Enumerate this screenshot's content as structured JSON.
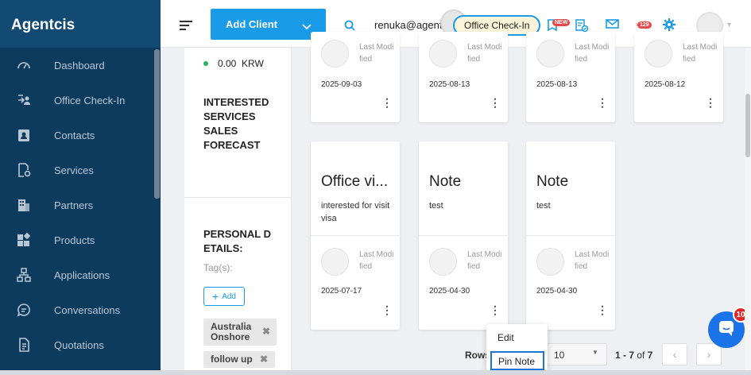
{
  "app": {
    "brand": "Agentcis"
  },
  "sidebar": {
    "items": [
      {
        "label": "Dashboard",
        "icon": "gauge-icon"
      },
      {
        "label": "Office Check-In",
        "icon": "checkin-icon"
      },
      {
        "label": "Contacts",
        "icon": "contact-card-icon"
      },
      {
        "label": "Services",
        "icon": "services-doc-icon"
      },
      {
        "label": "Partners",
        "icon": "building-icon"
      },
      {
        "label": "Products",
        "icon": "products-grid-icon"
      },
      {
        "label": "Applications",
        "icon": "flow-icon"
      },
      {
        "label": "Conversations",
        "icon": "chat-bubble-icon"
      },
      {
        "label": "Quotations",
        "icon": "document-icon"
      }
    ]
  },
  "header": {
    "add_client_label": "Add Client",
    "username": "renuka@agentcis",
    "checkin_label": "Office Check-In",
    "new_badge": "NEW",
    "notification_count": "129"
  },
  "detail": {
    "balance": "0.00",
    "currency": "KRW",
    "forecast_title": "INTERESTED SERVICES SALES FORECAST",
    "personal_title": "PERSONAL D ETAILS:",
    "tags_label": "Tag(s):",
    "add_tag_label": "Add",
    "tags": [
      "Australia Onshore",
      "follow up"
    ]
  },
  "cards_top": [
    {
      "modified_label": "Last Modified",
      "date": "2025-09-03"
    },
    {
      "modified_label": "Last Modified",
      "date": "2025-08-13"
    },
    {
      "modified_label": "Last Modified",
      "date": "2025-08-13"
    },
    {
      "modified_label": "Last Modified",
      "date": "2025-08-12"
    }
  ],
  "cards_bottom": [
    {
      "title": "Office vi...",
      "desc": "interested for visit visa",
      "modified_label": "Last Modified",
      "date": "2025-07-17"
    },
    {
      "title": "Note",
      "desc": "test",
      "modified_label": "Last Modified",
      "date": "2025-04-30"
    },
    {
      "title": "Note",
      "desc": "test",
      "modified_label": "Last Modified",
      "date": "2025-04-30"
    }
  ],
  "pagination": {
    "rows_label": "Rows",
    "rows_value": "10",
    "range": "1 - 7",
    "of_label": "of",
    "total": "7"
  },
  "context_menu": {
    "edit_label": "Edit",
    "pin_label": "Pin Note"
  },
  "chat": {
    "unread": "10"
  },
  "colors": {
    "sidebar": "#0d3b5e",
    "accent": "#1a9be8",
    "badge": "#e02424"
  }
}
